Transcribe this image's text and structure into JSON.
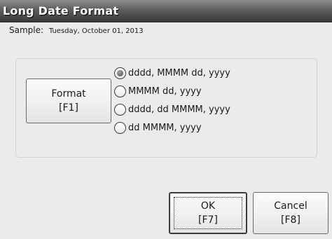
{
  "window": {
    "title": "Long Date Format"
  },
  "sample": {
    "label": "Sample:",
    "value": "Tuesday, October 01, 2013"
  },
  "format_button": {
    "line1": "Format",
    "line2": "[F1]"
  },
  "format_options": [
    {
      "label": "dddd, MMMM dd, yyyy",
      "selected": true
    },
    {
      "label": "MMMM dd, yyyy",
      "selected": false
    },
    {
      "label": "dddd, dd MMMM, yyyy",
      "selected": false
    },
    {
      "label": "dd MMMM, yyyy",
      "selected": false
    }
  ],
  "buttons": {
    "ok": {
      "line1": "OK",
      "line2": "[F7]"
    },
    "cancel": {
      "line1": "Cancel",
      "line2": "[F8]"
    }
  },
  "colors": {
    "dialog_background": "#ebebeb",
    "titlebar": "#5e5e5e",
    "title_text": "#ffffff"
  }
}
